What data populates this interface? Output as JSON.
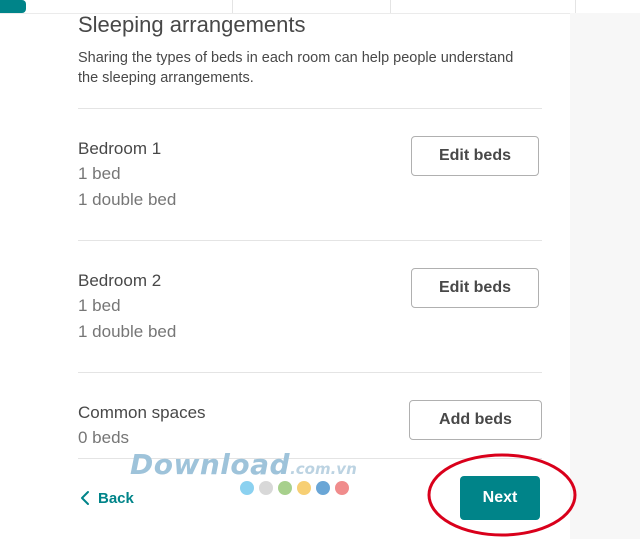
{
  "header": {
    "title": "Sleeping arrangements",
    "subtitle": "Sharing the types of beds in each room can help people understand the sleeping arrangements."
  },
  "rooms": [
    {
      "name": "Bedroom 1",
      "lines": [
        "1 bed",
        "1 double bed"
      ],
      "button": "Edit beds"
    },
    {
      "name": "Bedroom 2",
      "lines": [
        "1 bed",
        "1 double bed"
      ],
      "button": "Edit beds"
    },
    {
      "name": "Common spaces",
      "lines": [
        "0 beds"
      ],
      "button": "Add beds"
    }
  ],
  "footer": {
    "back_label": "Back",
    "next_label": "Next",
    "dot_colors": [
      "#8bd1f0",
      "#d8d8d8",
      "#a7d08c",
      "#f7cf74",
      "#6aa6d6",
      "#f08c8c"
    ]
  },
  "watermark": {
    "brand": "Download",
    "tld": ".com.vn"
  },
  "colors": {
    "accent": "#008489",
    "annotation": "#d9001b"
  }
}
